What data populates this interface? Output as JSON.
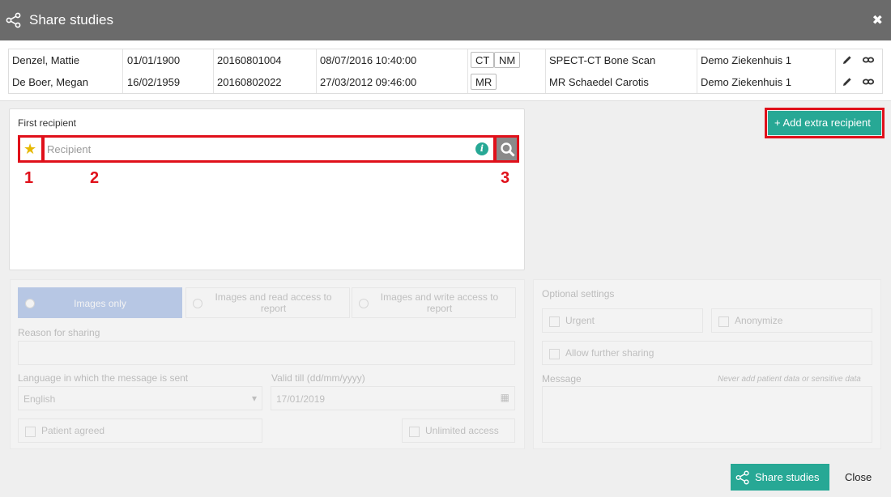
{
  "dialog": {
    "title": "Share studies"
  },
  "studies": [
    {
      "name": "Denzel, Mattie",
      "dob": "01/01/1900",
      "study_id": "20160801004",
      "date": "08/07/2016 10:40:00",
      "modalities": [
        "CT",
        "NM"
      ],
      "description": "SPECT-CT Bone Scan",
      "hospital": "Demo Ziekenhuis 1"
    },
    {
      "name": "De Boer, Megan",
      "dob": "16/02/1959",
      "study_id": "20160802022",
      "date": "27/03/2012 09:46:00",
      "modalities": [
        "MR"
      ],
      "description": "MR Schaedel Carotis",
      "hospital": "Demo Ziekenhuis 1"
    }
  ],
  "recipient": {
    "label": "First recipient",
    "placeholder": "Recipient",
    "annotations": [
      "1",
      "2",
      "3"
    ]
  },
  "add_recipient": {
    "label": "+ Add extra recipient"
  },
  "access": {
    "options": [
      "Images only",
      "Images and read access to report",
      "Images and write access to report"
    ],
    "reason_label": "Reason for sharing",
    "language_label": "Language in which the message is sent",
    "language_value": "English",
    "valid_till_label": "Valid till (dd/mm/yyyy)",
    "valid_till_value": "17/01/2019",
    "patient_agreed": "Patient agreed",
    "unlimited": "Unlimited access"
  },
  "optional": {
    "title": "Optional settings",
    "urgent": "Urgent",
    "anonymize": "Anonymize",
    "further_sharing": "Allow further sharing",
    "message_label": "Message",
    "message_hint": "Never add patient data or sensitive data"
  },
  "footer": {
    "share_label": "Share studies",
    "close_label": "Close"
  },
  "colors": {
    "accent": "#27a895",
    "annotation": "#e0101a",
    "titlebar": "#6b6b6b",
    "selected": "#2b63c9"
  }
}
